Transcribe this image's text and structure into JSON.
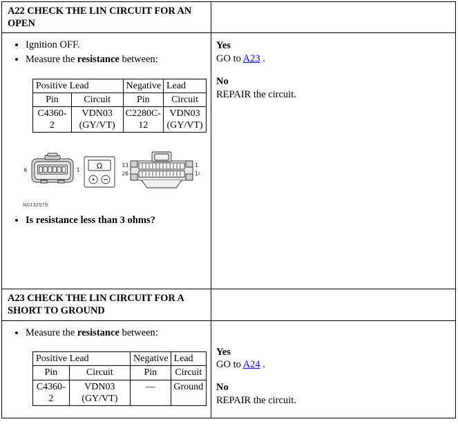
{
  "document": {
    "type": "diagnostic-pinpoint-test",
    "link_color": "#0000cc"
  },
  "steps": [
    {
      "id": "A22",
      "header": "A22 CHECK THE LIN CIRCUIT FOR AN OPEN",
      "bullets_before": [
        "Ignition OFF.",
        "Measure the resistance between:"
      ],
      "bullet_measure_prefix": "Measure the ",
      "bullet_measure_bold": "resistance",
      "bullet_measure_suffix": " between:",
      "table": {
        "group_headers": [
          "Positive Lead",
          "Negative",
          "Lead"
        ],
        "column_headers": [
          "Pin",
          "Circuit",
          "Pin",
          "Circuit"
        ],
        "rows": [
          [
            "C4360-2",
            "VDN03 (GY/VT)",
            "C2280C-12",
            "VDN03 (GY/VT)"
          ]
        ]
      },
      "figure": {
        "id_label": "N0132579",
        "connector_left": {
          "pin_left": "6",
          "pin_right": "1",
          "cavities": 6
        },
        "meter": {
          "symbol": "Ω",
          "positive_terminal": "+",
          "negative_terminal": "−"
        },
        "connector_right": {
          "pin_top_left": "13",
          "pin_bottom_left": "26",
          "pin_top_right": "1",
          "pin_bottom_right": "14",
          "cavities_per_row": 13
        }
      },
      "question": "Is resistance less than 3 ohms?",
      "answers": {
        "yes_label": "Yes",
        "yes_prefix": "GO to ",
        "yes_link": "A23",
        "yes_suffix": " .",
        "no_label": "No",
        "no_text": "REPAIR the circuit."
      }
    },
    {
      "id": "A23",
      "header": "A23 CHECK THE LIN CIRCUIT FOR A SHORT TO GROUND",
      "bullets_before": [
        "Measure the resistance between:"
      ],
      "bullet_measure_prefix": "Measure the ",
      "bullet_measure_bold": "resistance",
      "bullet_measure_suffix": " between:",
      "table": {
        "group_headers": [
          "Positive Lead",
          "Negative",
          "Lead"
        ],
        "column_headers": [
          "Pin",
          "Circuit",
          "Pin",
          "Circuit"
        ],
        "rows": [
          [
            "C4360-2",
            "VDN03 (GY/VT)",
            "—",
            "Ground"
          ]
        ]
      },
      "answers": {
        "yes_label": "Yes",
        "yes_prefix": "GO to ",
        "yes_link": "A24",
        "yes_suffix": " .",
        "no_label": "No",
        "no_text": "REPAIR the circuit."
      }
    }
  ]
}
